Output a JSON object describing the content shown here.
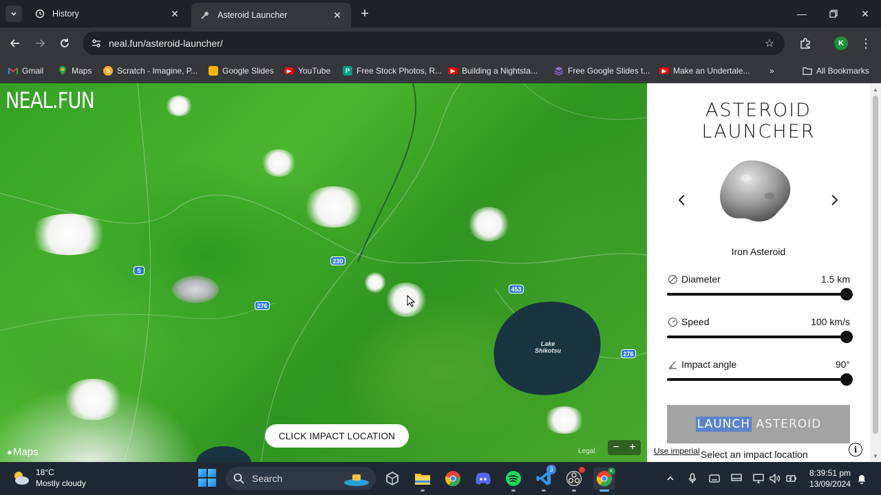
{
  "browser": {
    "tabs": [
      {
        "title": "History",
        "active": false
      },
      {
        "title": "Asteroid Launcher",
        "active": true
      }
    ],
    "url": "neal.fun/asteroid-launcher/",
    "profile_initial": "K",
    "bookmarks": [
      {
        "label": "Gmail",
        "icon": "gmail-icon"
      },
      {
        "label": "Maps",
        "icon": "maps-icon"
      },
      {
        "label": "Scratch - Imagine, P...",
        "icon": "scratch-icon"
      },
      {
        "label": "Google Slides",
        "icon": "slides-icon"
      },
      {
        "label": "YouTube",
        "icon": "youtube-icon"
      },
      {
        "label": "Free Stock Photos, R...",
        "icon": "pexels-icon"
      },
      {
        "label": "Building a Nightsta...",
        "icon": "youtube-icon"
      },
      {
        "label": "Free Google Slides t...",
        "icon": "slidesgo-icon"
      },
      {
        "label": "Make an Undertale...",
        "icon": "youtube-icon"
      }
    ],
    "all_bookmarks_label": "All Bookmarks",
    "colors": {
      "tab_bg": "#202124",
      "toolbar_bg": "#35363a",
      "youtube_red": "#ff0000",
      "slides_yellow": "#f6b400"
    }
  },
  "map": {
    "logo": "NEAL.FUN",
    "road_badges": [
      "5",
      "230",
      "276",
      "453",
      "276"
    ],
    "lake_label": "Lake Shikotsu",
    "impact_button": "CLICK IMPACT LOCATION",
    "maps_attribution": "Maps",
    "legal": "Legal",
    "zoom_out": "−",
    "zoom_in": "+"
  },
  "panel": {
    "title": "ASTEROID LAUNCHER",
    "asteroid_name": "Iron Asteroid",
    "params": {
      "diameter": {
        "label": "Diameter",
        "value": "1.5 km",
        "fraction": 1.0,
        "icon": "diameter-icon"
      },
      "speed": {
        "label": "Speed",
        "value": "100 km/s",
        "fraction": 1.0,
        "icon": "speedometer-icon"
      },
      "angle": {
        "label": "Impact angle",
        "value": "90°",
        "fraction": 1.0,
        "icon": "angle-icon"
      }
    },
    "launch_selected": "LAUNCH",
    "launch_rest": " ASTEROID",
    "imperial_link": "Use imperial",
    "status_message": "Select an impact location",
    "colors": {
      "launch_disabled": "#a3a3a3",
      "selection": "#5c83c8"
    }
  },
  "taskbar": {
    "weather_temp": "18°C",
    "weather_desc": "Mostly cloudy",
    "search_label": "Search",
    "apps": [
      "unity-icon",
      "file-explorer-icon",
      "chrome-icon",
      "discord-icon",
      "spotify-icon",
      "vscode-icon",
      "obs-icon",
      "chrome-profile-icon"
    ],
    "vscode_badge": "3",
    "time": "8:39:51 pm",
    "date": "13/09/2024"
  }
}
